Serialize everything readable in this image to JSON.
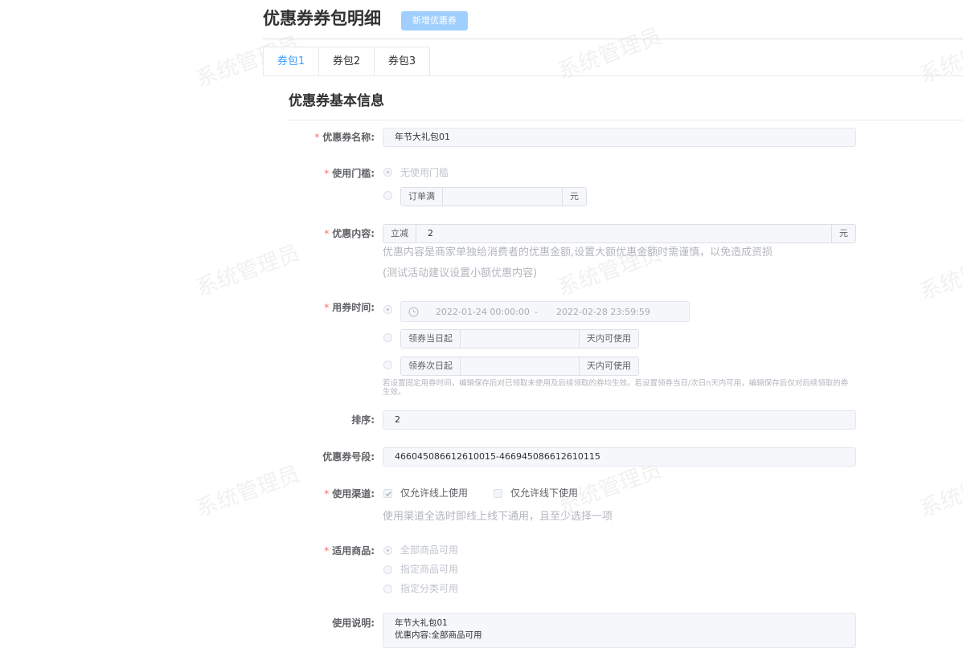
{
  "header": {
    "title": "优惠券券包明细",
    "add_button": "新增优惠券"
  },
  "tabs": [
    {
      "label": "券包1",
      "active": true
    },
    {
      "label": "券包2",
      "active": false
    },
    {
      "label": "券包3",
      "active": false
    }
  ],
  "section": {
    "title": "优惠券基本信息"
  },
  "watermark": "系统管理员",
  "form": {
    "name": {
      "label": "优惠券名称:",
      "value": "年节大礼包01"
    },
    "threshold": {
      "label": "使用门槛:",
      "option_none": "无使用门槛",
      "order_prefix": "订单满",
      "order_value": "",
      "order_suffix": "元"
    },
    "content": {
      "label": "优惠内容:",
      "prefix": "立减",
      "value": "2",
      "suffix": "元",
      "hint1": "优惠内容是商家单独给消费者的优惠金额,设置大额优惠金额时需谨慎，以免造成资损",
      "hint2": "(测试活动建议设置小额优惠内容)"
    },
    "time": {
      "label": "用券时间:",
      "start": "2022-01-24 00:00:00",
      "separator": "-",
      "end": "2022-02-28 23:59:59",
      "same_day_prefix": "领券当日起",
      "next_day_prefix": "领券次日起",
      "days_suffix": "天内可使用",
      "hint": "若设置固定用券时间，编辑保存后对已领取未使用及后续领取的券均生效。若设置领券当日/次日n天内可用，编辑保存后仅对后续领取的券生效。"
    },
    "sort": {
      "label": "排序:",
      "value": "2"
    },
    "code_range": {
      "label": "优惠券号段:",
      "value": "466045086612610015-466945086612610115"
    },
    "channel": {
      "label": "使用渠道:",
      "online": "仅允许线上使用",
      "offline": "仅允许线下使用",
      "hint": "使用渠道全选时即线上线下通用，且至少选择一项"
    },
    "goods": {
      "label": "适用商品:",
      "options": [
        "全部商品可用",
        "指定商品可用",
        "指定分类可用"
      ]
    },
    "desc": {
      "label": "使用说明:",
      "line1": "年节大礼包01",
      "line2": "优惠内容:全部商品可用"
    }
  }
}
